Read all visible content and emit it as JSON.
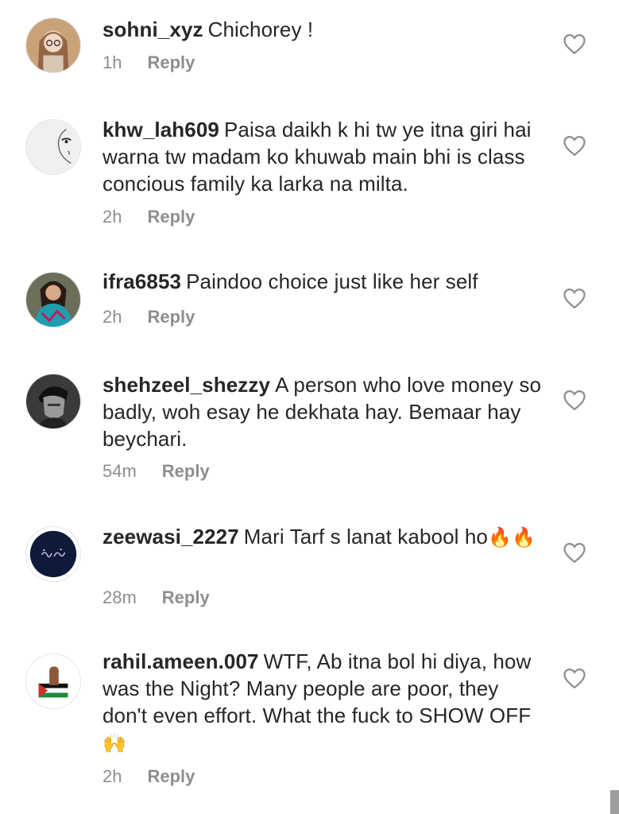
{
  "comments": [
    {
      "username": "sohni_xyz",
      "text": "Chichorey !",
      "time": "1h",
      "reply": "Reply",
      "avatar_icon": "girl-with-glasses-avatar"
    },
    {
      "username": "khw_lah609",
      "text": "Paisa daikh k hi tw ye itna giri hai warna tw madam ko khuwab main bhi is class concious family ka larka na milta.",
      "time": "2h",
      "reply": "Reply",
      "avatar_icon": "face-sketch-avatar"
    },
    {
      "username": "ifra6853",
      "text": "Paindoo choice just like her self",
      "time": "2h",
      "reply": "Reply",
      "avatar_icon": "woman-portrait-avatar"
    },
    {
      "username": "shehzeel_shezzy",
      "text": "A person who love money so badly, woh esay he dekhata hay. Bemaar hay beychari.",
      "time": "54m",
      "reply": "Reply",
      "avatar_icon": "man-portrait-avatar"
    },
    {
      "username": "zeewasi_2227",
      "text": "Mari Tarf s lanat kabool ho",
      "emoji": "🔥🔥",
      "time": "28m",
      "reply": "Reply",
      "avatar_icon": "script-logo-avatar"
    },
    {
      "username": "rahil.ameen.007",
      "text": "WTF, Ab itna bol hi diya, how was the Night? Many people are poor, they don't even effort. What the fuck to SHOW OFF",
      "emoji": "🙌",
      "time": "2h",
      "reply": "Reply",
      "avatar_icon": "raised-fist-flag-avatar"
    }
  ],
  "colors": {
    "text": "#262626",
    "meta": "#8e8e8e",
    "heart": "#8e8e8e",
    "fire": "#f4511e",
    "hands": "#f7b500"
  }
}
